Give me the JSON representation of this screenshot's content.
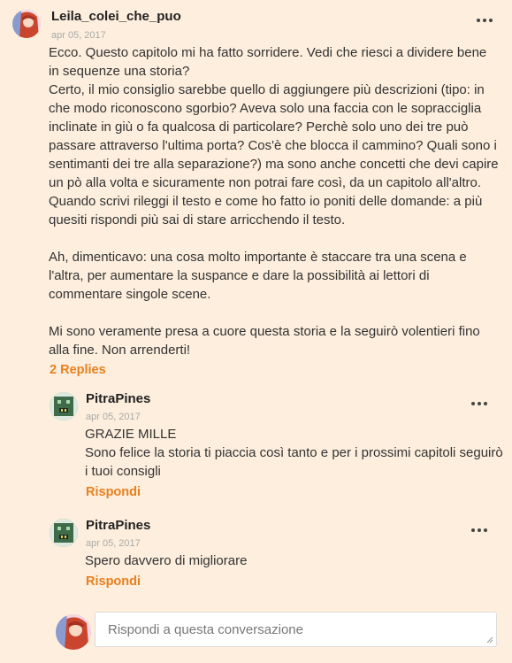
{
  "comment": {
    "username": "Leila_colei_che_puo",
    "date": "apr 05, 2017",
    "paragraphs": [
      "Ecco. Questo capitolo mi ha fatto sorridere. Vedi che riesci a dividere bene in sequenze una storia?\nCerto, il mio consiglio sarebbe quello di aggiungere più descrizioni (tipo: in che modo riconoscono sgorbio? Aveva solo una faccia con le sopracciglia inclinate in giù o fa qualcosa di particolare? Perchè solo uno dei tre può passare attraverso l'ultima porta? Cos'è che blocca il cammino? Quali sono i sentimanti dei tre alla separazione?) ma sono anche concetti che devi capire un pò alla volta e sicuramente non potrai fare così, da un capitolo all'altro. Quando scrivi rileggi il testo e come ho fatto io poniti delle domande: a più quesiti rispondi più sai di stare arricchendo il testo.",
      "Ah, dimenticavo: una cosa molto importante è staccare tra una scena e l'altra, per aumentare la suspance e dare la possibilità ai lettori di commentare singole scene.",
      "Mi sono veramente presa a cuore questa storia e la seguirò volentieri fino alla fine. Non arrenderti!"
    ],
    "replies_link": "2 Replies"
  },
  "replies": [
    {
      "username": "PitraPines",
      "date": "apr 05, 2017",
      "text": "GRAZIE MILLE\nSono felice la storia ti piaccia così tanto e per i prossimi capitoli seguirò i tuoi consigli",
      "reply_label": "Rispondi"
    },
    {
      "username": "PitraPines",
      "date": "apr 05, 2017",
      "text": "Spero davvero di migliorare",
      "reply_label": "Rispondi"
    }
  ],
  "reply_input": {
    "placeholder": "Rispondi a questa conversazione",
    "value": ""
  },
  "colors": {
    "background": "#fdeedd",
    "accent": "#e8801e"
  },
  "icons": {
    "more": "more-options-icon",
    "resize": "resize-grip-icon"
  }
}
